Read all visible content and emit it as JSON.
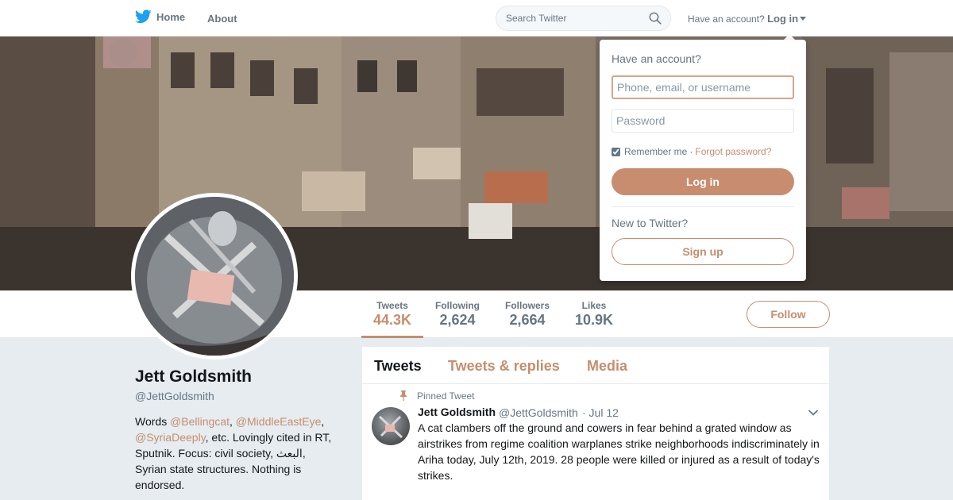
{
  "topbar": {
    "home_label": "Home",
    "about_label": "About",
    "search_placeholder": "Search Twitter",
    "have_account": "Have an account?",
    "login_link": "Log in"
  },
  "profile": {
    "name": "Jett Goldsmith",
    "handle": "@JettGoldsmith",
    "bio": {
      "words": "Words ",
      "mention1": "@Bellingcat",
      "sep1": ", ",
      "mention2": "@MiddleEastEye",
      "sep2": ", ",
      "mention3": "@SyriaDeeply",
      "rest": ", etc. Lovingly cited in RT, Sputnik. Focus: civil society, البعث, Syrian state structures. Nothing is endorsed."
    }
  },
  "stats": [
    {
      "label": "Tweets",
      "value": "44.3K"
    },
    {
      "label": "Following",
      "value": "2,624"
    },
    {
      "label": "Followers",
      "value": "2,664"
    },
    {
      "label": "Likes",
      "value": "10.9K"
    }
  ],
  "follow_label": "Follow",
  "timeline": {
    "tabs": [
      "Tweets",
      "Tweets & replies",
      "Media"
    ],
    "pinned_label": "Pinned Tweet",
    "tweet": {
      "name": "Jett Goldsmith",
      "handle": "@JettGoldsmith",
      "date": "· Jul 12",
      "text": "A cat clambers off the ground and cowers in fear behind a grated window as airstrikes from regime coalition warplanes strike neighborhoods indiscriminately in Ariha today, July 12th, 2019. 28 people were killed or injured as a result of today's strikes."
    }
  },
  "login_dropdown": {
    "title": "Have an account?",
    "username_placeholder": "Phone, email, or username",
    "password_placeholder": "Password",
    "remember": "Remember me",
    "separator": "·",
    "forgot": "Forgot password?",
    "login_button": "Log in",
    "new_to_twitter": "New to Twitter?",
    "signup_button": "Sign up"
  },
  "colors": {
    "accent": "#c78d6e",
    "twitter_blue": "#1da1f2",
    "text_secondary": "#66757f"
  },
  "icons": [
    "twitter-bird-icon",
    "search-icon",
    "caret-down-icon",
    "pin-icon",
    "chevron-down-icon"
  ]
}
